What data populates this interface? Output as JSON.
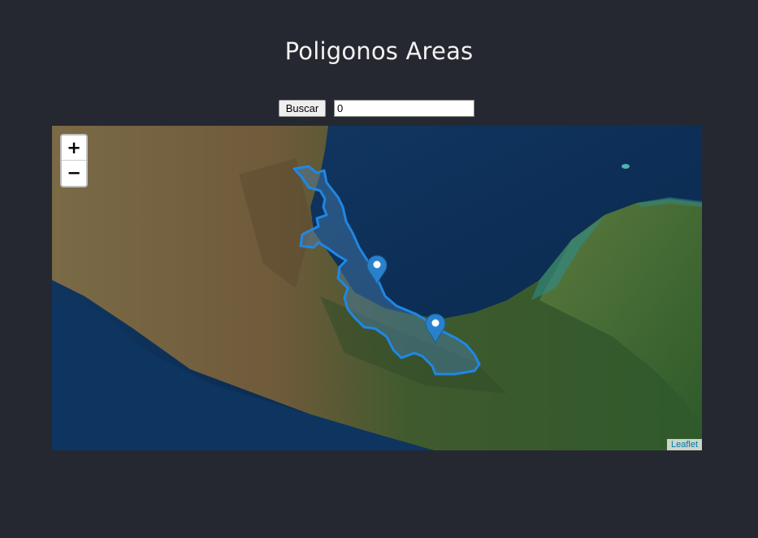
{
  "page": {
    "title": "Poligonos Areas"
  },
  "search": {
    "button_label": "Buscar",
    "input_value": "0"
  },
  "map": {
    "zoom_in_label": "+",
    "zoom_out_label": "−",
    "attribution": "Leaflet",
    "polygon_color": "#1e88e5",
    "marker_color": "#2a81cb",
    "marker_count": 2
  }
}
